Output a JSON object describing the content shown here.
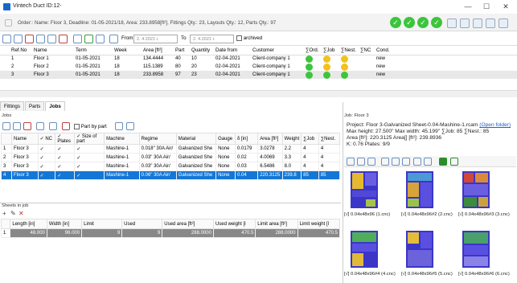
{
  "window": {
    "title": "Vintech Duct ID:12-",
    "min": "—",
    "max": "☐",
    "close": "✕"
  },
  "order": {
    "label": "Order:: Name: Floor 3, Deadline: 01-05-2021/18, Area: 233.8958[ft²], Fittings Qty.: 23, Layouts Qty.: 12, Parts Qty.: 97",
    "check": "✓"
  },
  "toolbar": {
    "from": "From",
    "to": "To",
    "from_date": "2. 4.2021 r.",
    "to_date": "2. 4.2021 r.",
    "archived": "archived"
  },
  "orders_grid": {
    "headers": [
      "Ref.No",
      "Name",
      "Term",
      "Week",
      "Area [ft²]",
      "Part",
      "Quantity",
      "Date from",
      "Customer",
      "∑Ord.",
      "∑Job",
      "∑Nest.",
      "∑NC",
      "Cond."
    ],
    "rows": [
      {
        "ref": "1",
        "name": "Floor 1",
        "term": "01-05-2021",
        "week": "18",
        "area": "134.4444",
        "part": "40",
        "qty": "10",
        "date": "02-04-2021",
        "customer": "Client-company 1",
        "ord": "green",
        "job": "yellow",
        "nest": "yellow",
        "cond": "new"
      },
      {
        "ref": "2",
        "name": "Floor 2",
        "term": "01-05-2021",
        "week": "18",
        "area": "115.1389",
        "part": "80",
        "qty": "20",
        "date": "02-04-2021",
        "customer": "Client-company 1",
        "ord": "green",
        "job": "yellow",
        "nest": "yellow",
        "cond": "new"
      },
      {
        "ref": "3",
        "name": "Floor 3",
        "term": "01-05-2021",
        "week": "18",
        "area": "233.8958",
        "part": "97",
        "qty": "23",
        "date": "02-04-2021",
        "customer": "Client-company 1",
        "ord": "green",
        "job": "green",
        "nest": "green",
        "cond": "new"
      }
    ]
  },
  "tabs": [
    "Fittings",
    "Parts",
    "Jobs"
  ],
  "jobs": {
    "title": "Jobs",
    "part_by_part": "Part by part",
    "headers": [
      "Name",
      "✓ NC",
      "✓ Plates",
      "✓ Size of part",
      "Machine",
      "Regime",
      "Material",
      "Gauge",
      "δ [in]",
      "Area [ft²]",
      "Weight",
      "∑Job",
      "∑Nest."
    ],
    "rows": [
      {
        "n": "1",
        "name": "Floor 3",
        "nc": "✓",
        "pl": "✓",
        "sz": "✓",
        "mach": "Mashine-1",
        "reg": "0.018\" 30A  Air/",
        "mat": "Galvanized She",
        "gauge": "None",
        "d": "0.0179",
        "area": "3.0278",
        "w": "2.2",
        "j": "4",
        "ns": "4"
      },
      {
        "n": "2",
        "name": "Floor 3",
        "nc": "✓",
        "pl": "✓",
        "sz": "✓",
        "mach": "Mashine-1",
        "reg": "0.03\" 30A  Air/",
        "mat": "Galvanized She",
        "gauge": "None",
        "d": "0.02",
        "area": "4.0069",
        "w": "3.3",
        "j": "4",
        "ns": "4"
      },
      {
        "n": "3",
        "name": "Floor 3",
        "nc": "✓",
        "pl": "✓",
        "sz": "✓",
        "mach": "Mashine-1",
        "reg": "0.03\" 30A  Air/",
        "mat": "Galvanized She",
        "gauge": "None",
        "d": "0.03",
        "area": "6.5486",
        "w": "8.0",
        "j": "4",
        "ns": "4"
      },
      {
        "n": "4",
        "name": "Floor 3",
        "nc": "✓",
        "pl": "✓",
        "sz": "✓",
        "mach": "Mashine-1",
        "reg": "0.06\" 30A  Air/",
        "mat": "Galvanized She",
        "gauge": "None",
        "d": "0.04",
        "area": "220.3125",
        "w": "239.8",
        "j": "85",
        "ns": "85"
      }
    ]
  },
  "sheets": {
    "title": "Sheets in job",
    "headers": [
      "",
      "Length [in]",
      "Width [in]",
      "Limit",
      "Used",
      "Used area [ft²]",
      "Used weight [l",
      "Limit area [ft²]",
      "Limit weight [l"
    ],
    "row": {
      "n": "1",
      "len": "48.000",
      "wid": "96.000",
      "limit": "9",
      "used": "9",
      "ua": "288.0000",
      "uw": "470.5",
      "la": "288.0000",
      "lw": "470.5"
    }
  },
  "right": {
    "title": "Job: Floor 3",
    "line1": "Project: Floor 3-Galvanized Sheet-0.04-Mashine-1.rcam",
    "open": "(Open folder)",
    "line2": "Max height: 27.500\" Max width: 45.199\" ∑Job: 85 ∑Nest.: 85",
    "line3": "Area [ft²]: 220.3125 Area[] [ft²]: 239.8936",
    "line4": "K: 0.76 Plates: 9/9",
    "caps": [
      "[√] 0.04x48x96 (1.cnc)",
      "[√] 0.04x48x96#2 (2.cnc)",
      "[√] 0.04x48x96#3 (3.cnc)",
      "[√] 0.04x48x96#4 (4.cnc)",
      "[√] 0.04x48x96#5 (5.cnc)",
      "[√] 0.04x48x96#6 (6.cnc)"
    ]
  },
  "colors": {
    "green": "#3cc53c",
    "yellow": "#f2c21b",
    "select": "#1477d6",
    "sheet": "#3b35c8"
  }
}
